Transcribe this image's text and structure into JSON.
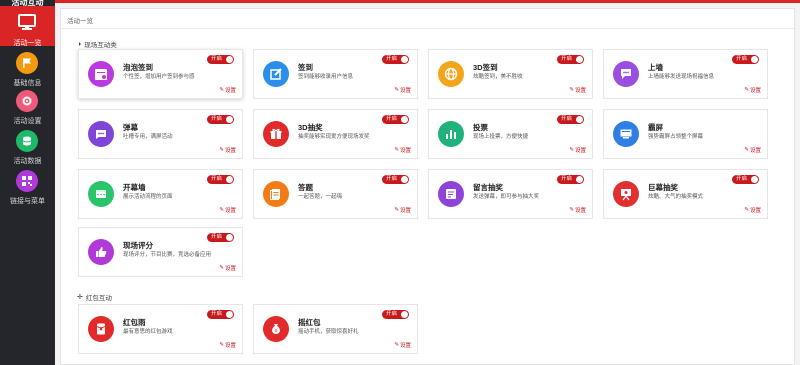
{
  "sidebar": {
    "brand": "活动互动",
    "items": [
      {
        "label": "活动一览",
        "icon": "monitor-icon",
        "color": "#d92525"
      },
      {
        "label": "基础信息",
        "icon": "flag-icon",
        "color": "#f59a0f"
      },
      {
        "label": "活动设置",
        "icon": "gear-icon",
        "color": "#ee5a7a"
      },
      {
        "label": "活动数据",
        "icon": "database-icon",
        "color": "#1fb96b"
      },
      {
        "label": "链接与菜单",
        "icon": "qrcode-icon",
        "color": "#b03ad9"
      }
    ]
  },
  "breadcrumb": "活动一览",
  "sections": [
    {
      "title": "现场互动类",
      "icon": "half-circle-icon"
    },
    {
      "title": "红包互动",
      "icon": "move-icon"
    }
  ],
  "toggle_label": "开启",
  "setting_label": "设置",
  "cards": [
    {
      "title": "泡泡签到",
      "desc": "个性签，增加用户签到参与感",
      "icon": "checkin-calendar-icon",
      "color": "#b93be0"
    },
    {
      "title": "签到",
      "desc": "签到能够收录用户信息",
      "icon": "edit-icon",
      "color": "#2b8ee8"
    },
    {
      "title": "3D签到",
      "desc": "炫酷签到，美不胜收",
      "icon": "globe-icon",
      "color": "#f4a51c"
    },
    {
      "title": "上墙",
      "desc": "上墙能够发送现场祝福信息",
      "icon": "chat-icon",
      "color": "#9b4fe0"
    },
    {
      "title": "弹幕",
      "desc": "吐槽专用，满屏活动",
      "icon": "comment-icon",
      "color": "#7f45d9"
    },
    {
      "title": "3D抽奖",
      "desc": "抽奖能够实现爱方便现场发奖",
      "icon": "gift-icon",
      "color": "#e22a2a"
    },
    {
      "title": "投票",
      "desc": "现场上投票，方便快捷",
      "icon": "bar-chart-icon",
      "color": "#1fb27a"
    },
    {
      "title": "霸屏",
      "desc": "强势霸屏占领整个屏幕",
      "icon": "screen-icon",
      "color": "#2f7fe6"
    },
    {
      "title": "开幕墙",
      "desc": "展示活动流程的页面",
      "icon": "grid-icon",
      "color": "#2ac46a"
    },
    {
      "title": "答题",
      "desc": "一起答题，一起嗨",
      "icon": "quiz-icon",
      "color": "#f47a16"
    },
    {
      "title": "留言抽奖",
      "desc": "发送弹幕，即可参与抽大奖",
      "icon": "message-icon",
      "color": "#8e44d8"
    },
    {
      "title": "巨幕抽奖",
      "desc": "炫酷、大气的抽奖模式",
      "icon": "presentation-icon",
      "color": "#e03030"
    },
    {
      "title": "现场评分",
      "desc": "现场评分，节目比赛，竞选必备应用",
      "icon": "thumbs-up-icon",
      "color": "#b03ad9"
    },
    {
      "title": "红包雨",
      "desc": "最有意思的红包游戏",
      "icon": "red-envelope-icon",
      "color": "#e22a2a"
    },
    {
      "title": "摇红包",
      "desc": "摇动手机，获取惊喜好礼",
      "icon": "money-bag-icon",
      "color": "#e22a2a"
    }
  ]
}
